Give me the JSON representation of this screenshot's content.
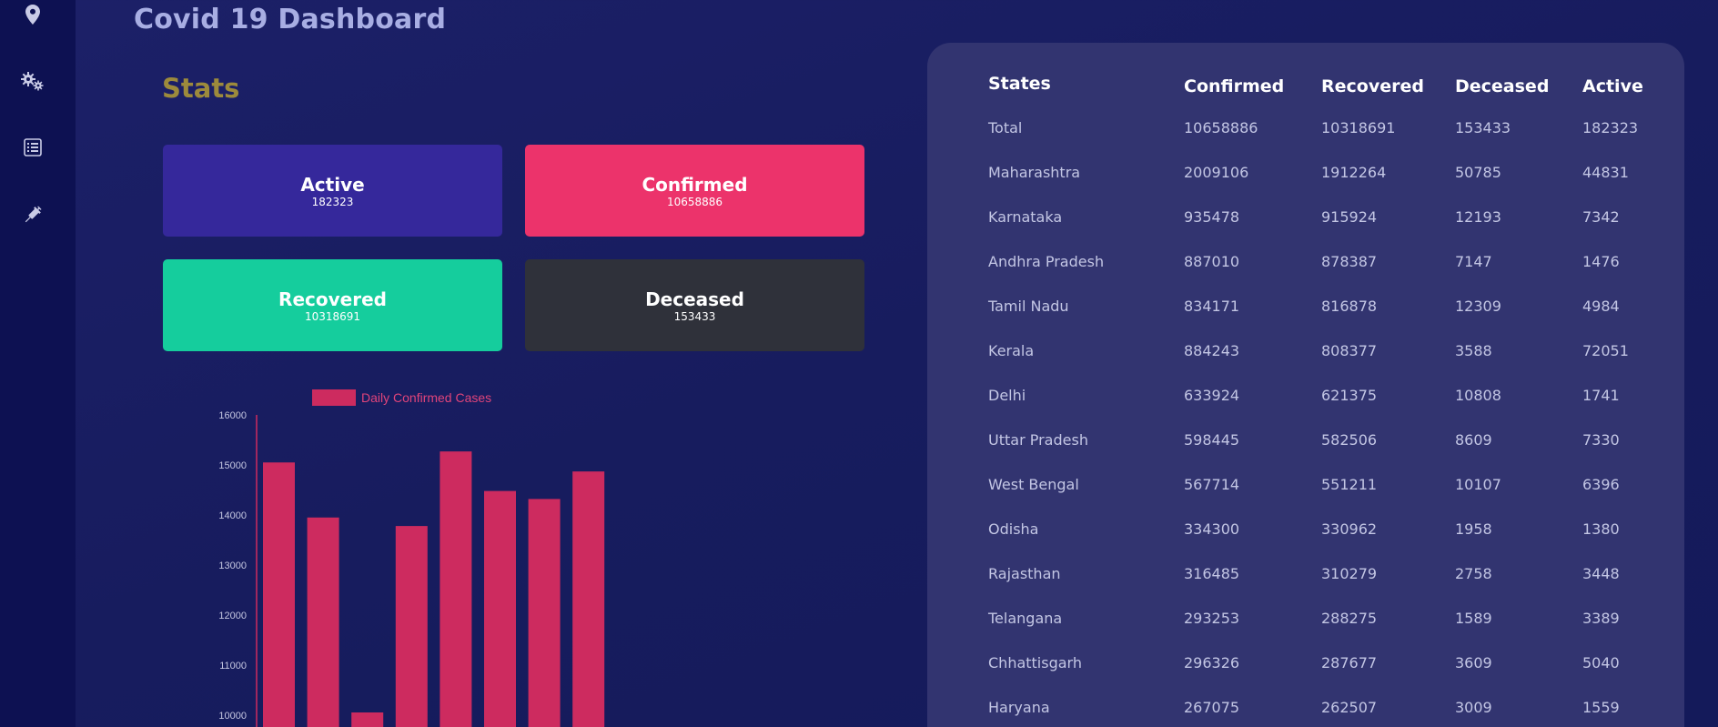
{
  "sidebar": {
    "items": [
      {
        "icon": "map-pin-icon"
      },
      {
        "icon": "gears-icon"
      },
      {
        "icon": "list-document-icon"
      },
      {
        "icon": "vaccine-syringe-icon"
      }
    ]
  },
  "header": {
    "title": "Covid 19 Dashboard"
  },
  "stats": {
    "title": "Stats",
    "cards": [
      {
        "label": "Active",
        "value": "182323",
        "color": "#35289b"
      },
      {
        "label": "Confirmed",
        "value": "10658886",
        "color": "#ec336b"
      },
      {
        "label": "Recovered",
        "value": "10318691",
        "color": "#15cd9d"
      },
      {
        "label": "Deceased",
        "value": "153433",
        "color": "#2f313a"
      }
    ]
  },
  "chart_data": {
    "type": "bar",
    "series": [
      {
        "name": "Daily Confirmed Cases",
        "color": "#cd2b5f"
      }
    ],
    "values": [
      15050,
      13950,
      10000,
      13780,
      15270,
      14480,
      14320,
      14870
    ],
    "y_ticks": [
      "16000",
      "15000",
      "14000",
      "13000",
      "12000",
      "11000",
      "10000"
    ],
    "ylim": [
      10000,
      16000
    ],
    "legend": "top"
  },
  "table": {
    "headers": [
      "States",
      "Confirmed",
      "Recovered",
      "Deceased",
      "Active"
    ],
    "rows": [
      [
        "Total",
        "10658886",
        "10318691",
        "153433",
        "182323"
      ],
      [
        "Maharashtra",
        "2009106",
        "1912264",
        "50785",
        "44831"
      ],
      [
        "Karnataka",
        "935478",
        "915924",
        "12193",
        "7342"
      ],
      [
        "Andhra Pradesh",
        "887010",
        "878387",
        "7147",
        "1476"
      ],
      [
        "Tamil Nadu",
        "834171",
        "816878",
        "12309",
        "4984"
      ],
      [
        "Kerala",
        "884243",
        "808377",
        "3588",
        "72051"
      ],
      [
        "Delhi",
        "633924",
        "621375",
        "10808",
        "1741"
      ],
      [
        "Uttar Pradesh",
        "598445",
        "582506",
        "8609",
        "7330"
      ],
      [
        "West Bengal",
        "567714",
        "551211",
        "10107",
        "6396"
      ],
      [
        "Odisha",
        "334300",
        "330962",
        "1958",
        "1380"
      ],
      [
        "Rajasthan",
        "316485",
        "310279",
        "2758",
        "3448"
      ],
      [
        "Telangana",
        "293253",
        "288275",
        "1589",
        "3389"
      ],
      [
        "Chhattisgarh",
        "296326",
        "287677",
        "3609",
        "5040"
      ],
      [
        "Haryana",
        "267075",
        "262507",
        "3009",
        "1559"
      ]
    ]
  }
}
